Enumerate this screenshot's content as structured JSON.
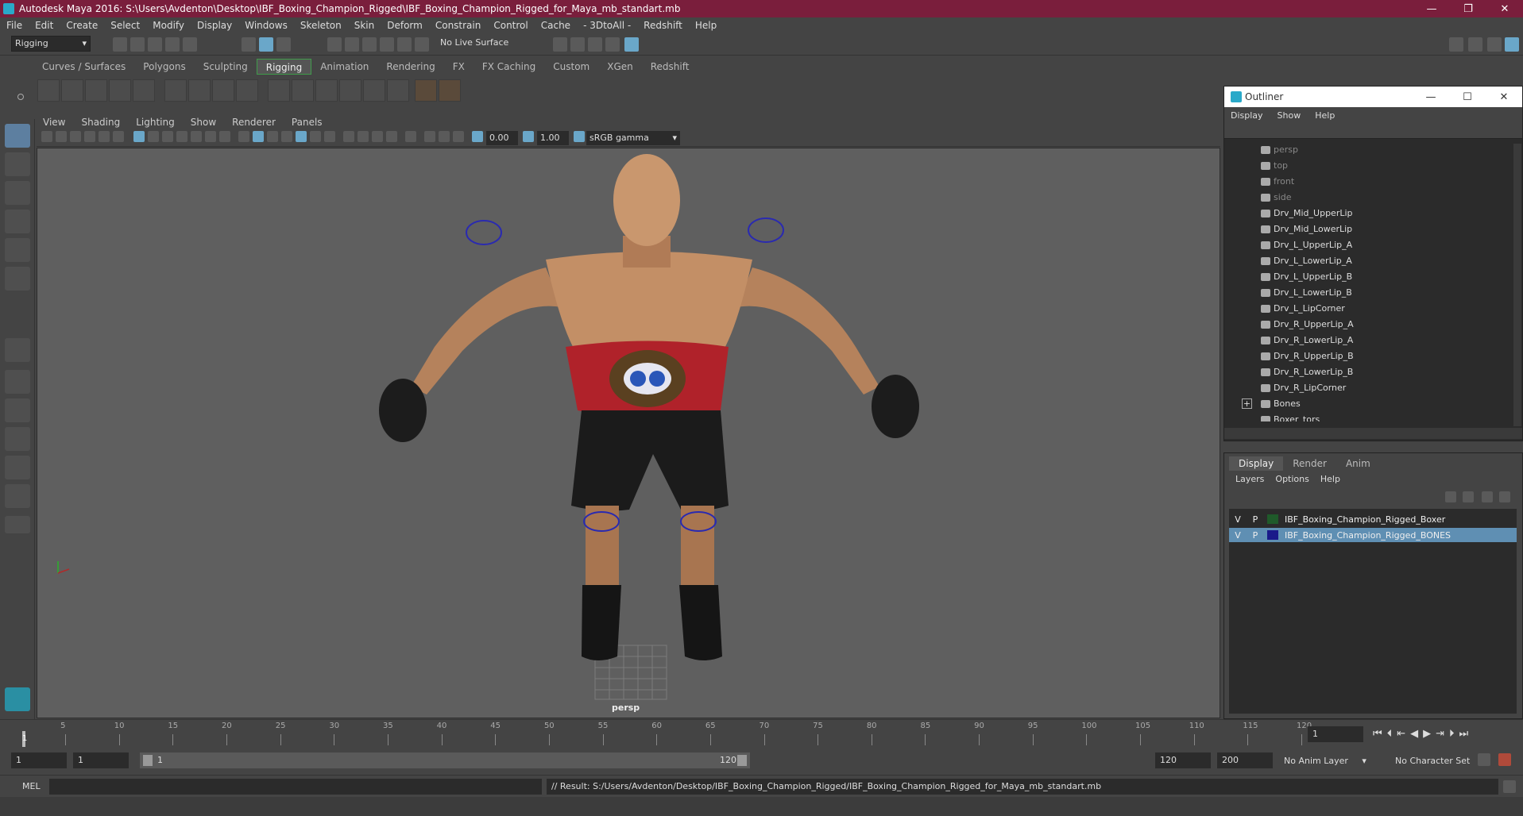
{
  "window": {
    "title": "Autodesk Maya 2016: S:\\Users\\Avdenton\\Desktop\\IBF_Boxing_Champion_Rigged\\IBF_Boxing_Champion_Rigged_for_Maya_mb_standart.mb",
    "minimize": "—",
    "restore": "❐",
    "close": "✕"
  },
  "menu": [
    "File",
    "Edit",
    "Create",
    "Select",
    "Modify",
    "Display",
    "Windows",
    "Skeleton",
    "Skin",
    "Deform",
    "Constrain",
    "Control",
    "Cache",
    "- 3DtoAll -",
    "Redshift",
    "Help"
  ],
  "status": {
    "mode": "Rigging",
    "live_surface": "No Live Surface"
  },
  "shelf_tabs": [
    "Curves / Surfaces",
    "Polygons",
    "Sculpting",
    "Rigging",
    "Animation",
    "Rendering",
    "FX",
    "FX Caching",
    "Custom",
    "XGen",
    "Redshift"
  ],
  "shelf_active": "Rigging",
  "viewport": {
    "menu": [
      "View",
      "Shading",
      "Lighting",
      "Show",
      "Renderer",
      "Panels"
    ],
    "exposure": "0.00",
    "gamma": "1.00",
    "color_space": "sRGB gamma",
    "camera": "persp"
  },
  "outliner": {
    "title": "Outliner",
    "menu": [
      "Display",
      "Show",
      "Help"
    ],
    "items": [
      {
        "name": "persp",
        "dim": true
      },
      {
        "name": "top",
        "dim": true
      },
      {
        "name": "front",
        "dim": true
      },
      {
        "name": "side",
        "dim": true
      },
      {
        "name": "Drv_Mid_UpperLip"
      },
      {
        "name": "Drv_Mid_LowerLip"
      },
      {
        "name": "Drv_L_UpperLip_A"
      },
      {
        "name": "Drv_L_LowerLip_A"
      },
      {
        "name": "Drv_L_UpperLip_B"
      },
      {
        "name": "Drv_L_LowerLip_B"
      },
      {
        "name": "Drv_L_LipCorner"
      },
      {
        "name": "Drv_R_UpperLip_A"
      },
      {
        "name": "Drv_R_LowerLip_A"
      },
      {
        "name": "Drv_R_UpperLip_B"
      },
      {
        "name": "Drv_R_LowerLip_B"
      },
      {
        "name": "Drv_R_LipCorner"
      },
      {
        "name": "Bones"
      },
      {
        "name": "Boxer_tors"
      }
    ]
  },
  "layers": {
    "tabs": [
      "Display",
      "Render",
      "Anim"
    ],
    "menu": [
      "Layers",
      "Options",
      "Help"
    ],
    "rows": [
      {
        "v": "V",
        "p": "P",
        "name": "IBF_Boxing_Champion_Rigged_Boxer",
        "color": "#1f5a2a",
        "selected": false
      },
      {
        "v": "V",
        "p": "P",
        "name": "IBF_Boxing_Champion_Rigged_BONES",
        "color": "#1a1a8a",
        "selected": true
      }
    ]
  },
  "timeline": {
    "ticks": [
      "5",
      "10",
      "15",
      "20",
      "25",
      "30",
      "35",
      "40",
      "45",
      "50",
      "55",
      "60",
      "65",
      "70",
      "75",
      "80",
      "85",
      "90",
      "95",
      "100",
      "105",
      "110",
      "115",
      "120"
    ],
    "first_tick": "1",
    "current_frame": "1"
  },
  "range": {
    "start": "1",
    "playback_start": "1",
    "slider_start": "1",
    "slider_end": "120",
    "playback_end": "120",
    "end": "200",
    "anim_layer": "No Anim Layer",
    "char_set": "No Character Set"
  },
  "cmd": {
    "label": "MEL",
    "result": "// Result: S:/Users/Avdenton/Desktop/IBF_Boxing_Champion_Rigged/IBF_Boxing_Champion_Rigged_for_Maya_mb_standart.mb"
  }
}
